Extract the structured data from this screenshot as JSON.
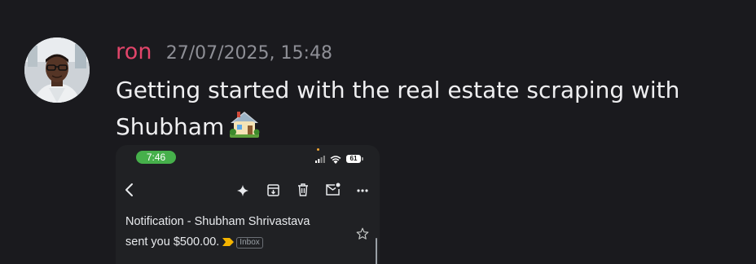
{
  "message": {
    "username": "ron",
    "timestamp": "27/07/2025, 15:48",
    "text": "Getting started with the real estate scraping with Shubham",
    "emoji": "house-with-garden-icon"
  },
  "attachment": {
    "status_bar": {
      "time": "7:46",
      "battery": "61"
    },
    "toolbar_icons": [
      "back-arrow-icon",
      "sparkle-icon",
      "archive-icon",
      "delete-icon",
      "mark-unread-icon",
      "more-options-icon"
    ],
    "email": {
      "subject_line1": "Notification - Shubham  Shrivastava",
      "subject_line2": "sent you $500.00.",
      "label": "Inbox"
    }
  },
  "colors": {
    "background": "#1a1a1e",
    "username": "#e2456a",
    "timestamp": "#8e8f96",
    "text": "#efeff1",
    "status_pill": "#46b04b",
    "importance_marker": "#f4b400"
  }
}
